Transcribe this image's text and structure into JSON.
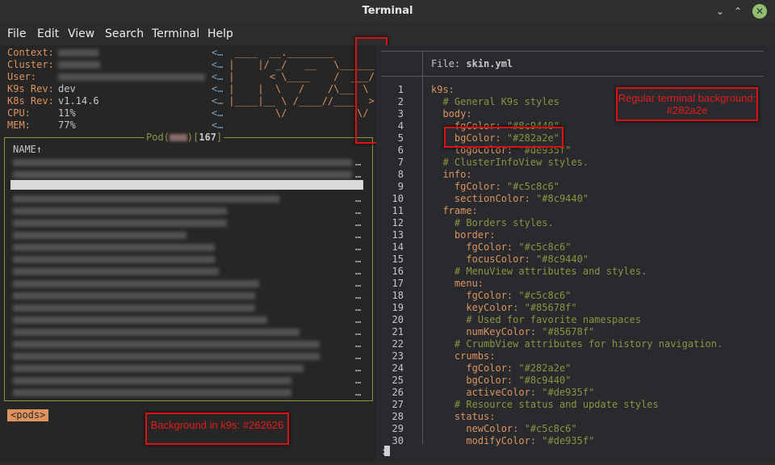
{
  "window": {
    "title": "Terminal",
    "controls": {
      "minimize": "⌄",
      "maximize": "⌃",
      "close": "✕"
    }
  },
  "menu": [
    "File",
    "Edit",
    "View",
    "Search",
    "Terminal",
    "Help"
  ],
  "k9s": {
    "info": [
      {
        "key": "Context:",
        "value": ""
      },
      {
        "key": "Cluster:",
        "value": ""
      },
      {
        "key": "User:",
        "value": ""
      },
      {
        "key": "K9s Rev:",
        "value": "dev"
      },
      {
        "key": "K8s Rev:",
        "value": "v1.14.6"
      },
      {
        "key": "CPU:",
        "value": "11%"
      },
      {
        "key": "MEM:",
        "value": "77%"
      }
    ],
    "menu_hint": "<…",
    "logo": [
      "  ____  __.________       ",
      " |    |/ _/   __   \\______",
      " |      < \\____    /  ___/",
      " |    |  \\   /    /\\___ \\ ",
      " |____|__ \\ /____//____  >",
      "         \\/            \\/ ",
      "                          "
    ],
    "pods_title_prefix": "Pod(",
    "pods_title_ns": "",
    "pods_title_mid": ")[",
    "pods_count": "167",
    "pods_title_suffix": "]",
    "column_header": "NAME↑",
    "row_ellipsis": "…",
    "crumb": "<pods>"
  },
  "annotations": {
    "k9s_bg": "Background in k9s: #262626",
    "terminal_bg": "Regular terminal background: #282a2e"
  },
  "file": {
    "label": "File:",
    "name": "skin.yml"
  },
  "code_lines": [
    {
      "n": "1",
      "parts": [
        [
          "k9s:",
          "gold"
        ]
      ]
    },
    {
      "n": "2",
      "parts": [
        [
          "  # General K9s styles",
          "olive"
        ]
      ]
    },
    {
      "n": "3",
      "parts": [
        [
          "  body:",
          "gold"
        ]
      ]
    },
    {
      "n": "4",
      "parts": [
        [
          "    fgColor: ",
          "gold"
        ],
        [
          "\"#8c9440\"",
          "olive"
        ]
      ]
    },
    {
      "n": "5",
      "parts": [
        [
          "    bgColor: ",
          "gold"
        ],
        [
          "\"#282a2e\"",
          "olive"
        ]
      ]
    },
    {
      "n": "6",
      "parts": [
        [
          "    logoColor: ",
          "gold"
        ],
        [
          "\"#de935f\"",
          "olive"
        ]
      ]
    },
    {
      "n": "7",
      "parts": [
        [
          "  # ClusterInfoView styles.",
          "olive"
        ]
      ]
    },
    {
      "n": "8",
      "parts": [
        [
          "  info:",
          "gold"
        ]
      ]
    },
    {
      "n": "9",
      "parts": [
        [
          "    fgColor: ",
          "gold"
        ],
        [
          "\"#c5c8c6\"",
          "olive"
        ]
      ]
    },
    {
      "n": "10",
      "parts": [
        [
          "    sectionColor: ",
          "gold"
        ],
        [
          "\"#8c9440\"",
          "olive"
        ]
      ]
    },
    {
      "n": "11",
      "parts": [
        [
          "  frame:",
          "gold"
        ]
      ]
    },
    {
      "n": "12",
      "parts": [
        [
          "    # Borders styles.",
          "olive"
        ]
      ]
    },
    {
      "n": "13",
      "parts": [
        [
          "    border:",
          "gold"
        ]
      ]
    },
    {
      "n": "14",
      "parts": [
        [
          "      fgColor: ",
          "gold"
        ],
        [
          "\"#c5c8c6\"",
          "olive"
        ]
      ]
    },
    {
      "n": "15",
      "parts": [
        [
          "      focusColor: ",
          "gold"
        ],
        [
          "\"#8c9440\"",
          "olive"
        ]
      ]
    },
    {
      "n": "16",
      "parts": [
        [
          "    # MenuView attributes and styles.",
          "olive"
        ]
      ]
    },
    {
      "n": "17",
      "parts": [
        [
          "    menu:",
          "gold"
        ]
      ]
    },
    {
      "n": "18",
      "parts": [
        [
          "      fgColor: ",
          "gold"
        ],
        [
          "\"#c5c8c6\"",
          "olive"
        ]
      ]
    },
    {
      "n": "19",
      "parts": [
        [
          "      keyColor: ",
          "gold"
        ],
        [
          "\"#85678f\"",
          "olive"
        ]
      ]
    },
    {
      "n": "20",
      "parts": [
        [
          "      # Used for favorite namespaces",
          "olive"
        ]
      ]
    },
    {
      "n": "21",
      "parts": [
        [
          "      numKeyColor: ",
          "gold"
        ],
        [
          "\"#85678f\"",
          "olive"
        ]
      ]
    },
    {
      "n": "22",
      "parts": [
        [
          "    # CrumbView attributes for history navigation.",
          "olive"
        ]
      ]
    },
    {
      "n": "23",
      "parts": [
        [
          "    crumbs:",
          "gold"
        ]
      ]
    },
    {
      "n": "24",
      "parts": [
        [
          "      fgColor: ",
          "gold"
        ],
        [
          "\"#282a2e\"",
          "olive"
        ]
      ]
    },
    {
      "n": "25",
      "parts": [
        [
          "      bgColor: ",
          "gold"
        ],
        [
          "\"#8c9440\"",
          "olive"
        ]
      ]
    },
    {
      "n": "26",
      "parts": [
        [
          "      activeColor: ",
          "gold"
        ],
        [
          "\"#de935f\"",
          "olive"
        ]
      ]
    },
    {
      "n": "27",
      "parts": [
        [
          "    # Resource status and update styles",
          "olive"
        ]
      ]
    },
    {
      "n": "28",
      "parts": [
        [
          "    status:",
          "gold"
        ]
      ]
    },
    {
      "n": "29",
      "parts": [
        [
          "      newColor: ",
          "gold"
        ],
        [
          "\"#c5c8c6\"",
          "olive"
        ]
      ]
    },
    {
      "n": "30",
      "parts": [
        [
          "      modifyColor: ",
          "gold"
        ],
        [
          "\"#de935f\"",
          "olive"
        ]
      ]
    }
  ],
  "vim_prompt": ":",
  "colors": {
    "k9s_background": "#262626",
    "terminal_background": "#282a2e",
    "key": "#de935f",
    "value": "#8c9440",
    "text": "#c5c8c6",
    "annotation": "#e51b1b"
  }
}
